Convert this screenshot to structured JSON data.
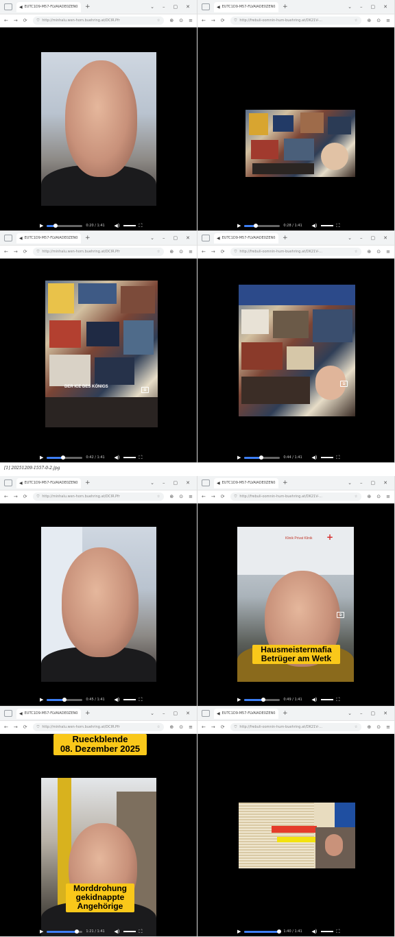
{
  "composite_top": {
    "panels": [
      {
        "tab_title": "EUTC1D9-M57-FLVAIADE0ZEN0.8 ×",
        "url": "http://minhalu.wen-horn.buehring.at/DCIR.Pfr",
        "time": "0:20 / 1:41"
      },
      {
        "tab_title": "EUTC1D9-M57-FLVAIADE0ZEN0.8 ×",
        "url": "http://frebuli-oomnin-hum-buehring.at/DK21V-...",
        "time": "0:28 / 1:41"
      },
      {
        "tab_title": "EUTC1D9-M57-FLVAIADE0ZEN0.8 ×",
        "url": "http://minhalu.wen-horn.buehring.at/DCIR.Pfr",
        "time": "0:42 / 1:41",
        "overlay": "DER ICE DES KÖNIGS"
      },
      {
        "tab_title": "EUTC1D9-M57-FLVAIADE0ZEN0.8 ×",
        "url": "http://frebuli-oomnin-hum-buehring.at/DK21V-...",
        "time": "0:44 / 1:41"
      }
    ]
  },
  "caption": "[1] 20251209-1557-0-2.jpg",
  "composite_bottom": {
    "panels": [
      {
        "tab_title": "EUTC1D9-M57-FLVAIADE0ZEN0.8 ×",
        "url": "http://minhalu.wen-horn.buehring.at/DCIR.Pfr",
        "time": "0:45 / 1:41"
      },
      {
        "tab_title": "EUTC1D9-M57-FLVAIADE0ZEN0.8 ×",
        "url": "http://frebuli-oomnin-hum-buehring.at/DK21V-...",
        "time": "0:49 / 1:41",
        "sign": "Klinik Privat Klinik",
        "overlay_line1": "Hausmeistermafia",
        "overlay_line2": "Betrüger am Wetk"
      },
      {
        "tab_title": "EUTC1D9-M57-FLVAIADE0ZEN0.8 ×",
        "url": "http://minhalu.wen-horn.buehring.at/DCIR.Pfr",
        "time": "1:21 / 1:41",
        "top_line1": "Rueckblende",
        "top_line2": "08. Dezember 2025",
        "bot_line1": "Morddrohung",
        "bot_line2": "gekidnappte",
        "bot_line3": "Angehörige"
      },
      {
        "tab_title": "EUTC1D9-M57-FLVAIADE0ZEN0.8 ×",
        "url": "http://frebuli-oomnin-hum-buehring.at/DK21V-...",
        "time": "1:40 / 1:41"
      }
    ]
  },
  "icons": {
    "speaker": "speaker-icon",
    "play": "play-icon",
    "volume": "volume-icon",
    "fullscreen": "fullscreen-icon",
    "pip": "picture-in-picture-icon"
  },
  "colors": {
    "overlay_yellow": "#f9c81a",
    "seek_blue": "#3d7ff5",
    "video_bg": "#000000"
  },
  "progress": [
    0.2,
    0.28,
    0.42,
    0.44,
    0.45,
    0.49,
    0.8,
    0.99
  ]
}
